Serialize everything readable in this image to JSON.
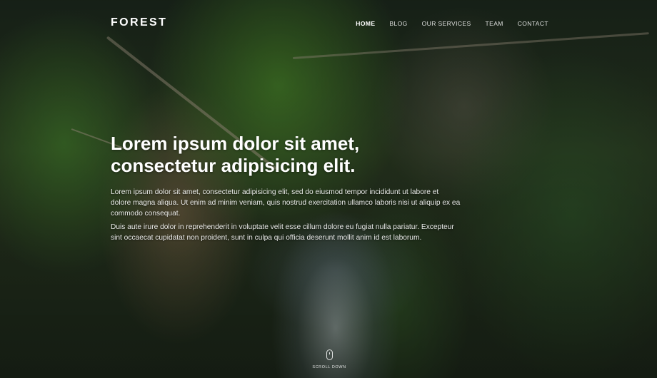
{
  "brand": {
    "name": "FOREST"
  },
  "nav": {
    "items": [
      {
        "label": "HOME",
        "active": true
      },
      {
        "label": "BLOG",
        "active": false
      },
      {
        "label": "OUR SERVICES",
        "active": false
      },
      {
        "label": "TEAM",
        "active": false
      },
      {
        "label": "CONTACT",
        "active": false
      }
    ]
  },
  "hero": {
    "title": "Lorem ipsum dolor sit amet, consectetur adipisicing elit.",
    "paragraph1": "Lorem ipsum dolor sit amet, consectetur adipisicing elit, sed do eiusmod tempor incididunt ut labore et dolore magna aliqua. Ut enim ad minim veniam, quis nostrud exercitation ullamco laboris nisi ut aliquip ex ea commodo consequat.",
    "paragraph2": "Duis aute irure dolor in reprehenderit in voluptate velit esse cillum dolore eu fugiat nulla pariatur. Excepteur sint occaecat cupidatat non proident, sunt in culpa qui officia deserunt mollit anim id est laborum.",
    "scroll_label": "SCROLL DOWN",
    "scroll_icon": "mouse-icon"
  }
}
